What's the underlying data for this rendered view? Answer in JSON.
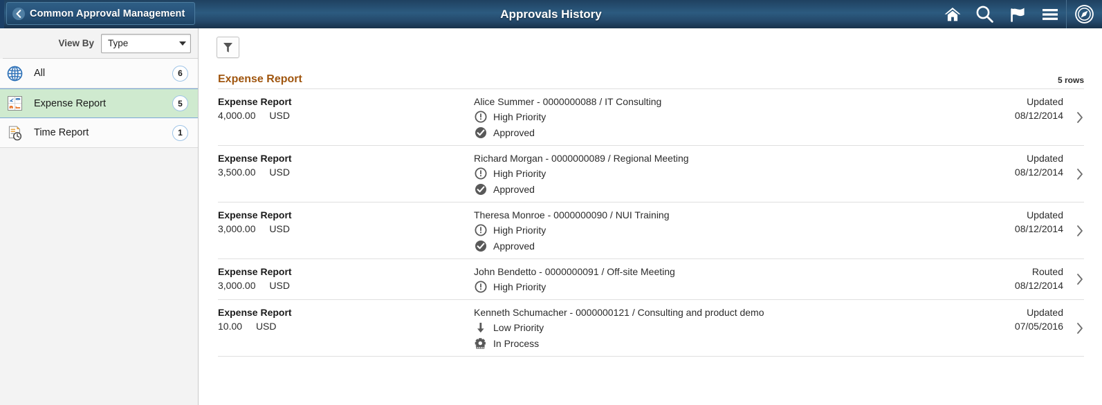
{
  "header": {
    "back_label": "Common Approval Management",
    "title": "Approvals History",
    "icons": [
      {
        "name": "home-icon",
        "label": "Home"
      },
      {
        "name": "search-icon",
        "label": "Search"
      },
      {
        "name": "flag-icon",
        "label": "Notifications"
      },
      {
        "name": "hamburger-menu-icon",
        "label": "Actions"
      },
      {
        "name": "navbar-compass-icon",
        "label": "NavBar"
      }
    ],
    "theme_color": "#2c5b80"
  },
  "sidebar": {
    "view_by_label": "View By",
    "view_by_value": "Type",
    "view_by_options": [
      "Type"
    ],
    "items": [
      {
        "label": "All",
        "count": "6",
        "icon": "globe-icon",
        "selected": false
      },
      {
        "label": "Expense Report",
        "count": "5",
        "icon": "expense-report-icon",
        "selected": true
      },
      {
        "label": "Time Report",
        "count": "1",
        "icon": "time-report-icon",
        "selected": false
      }
    ],
    "selected_bg": "#cfeacf"
  },
  "main": {
    "filter_button_icon": "filter-funnel-icon",
    "section_title": "Expense Report",
    "section_title_color": "#a0560f",
    "rows_count_label": "5 rows",
    "rows": [
      {
        "type": "Expense Report",
        "amount": "4,000.00",
        "currency": "USD",
        "detail": "Alice Summer - 0000000088 / IT Consulting",
        "priority": "High Priority",
        "priority_icon": "exclamation-circle-icon",
        "status": "Approved",
        "status_icon": "check-circle-icon",
        "updated_label": "Updated",
        "updated_date": "08/12/2014"
      },
      {
        "type": "Expense Report",
        "amount": "3,500.00",
        "currency": "USD",
        "detail": "Richard Morgan - 0000000089 / Regional Meeting",
        "priority": "High Priority",
        "priority_icon": "exclamation-circle-icon",
        "status": "Approved",
        "status_icon": "check-circle-icon",
        "updated_label": "Updated",
        "updated_date": "08/12/2014"
      },
      {
        "type": "Expense Report",
        "amount": "3,000.00",
        "currency": "USD",
        "detail": "Theresa Monroe - 0000000090 / NUI Training",
        "priority": "High Priority",
        "priority_icon": "exclamation-circle-icon",
        "status": "Approved",
        "status_icon": "check-circle-icon",
        "updated_label": "Updated",
        "updated_date": "08/12/2014"
      },
      {
        "type": "Expense Report",
        "amount": "3,000.00",
        "currency": "USD",
        "detail": "John Bendetto - 0000000091 / Off-site Meeting",
        "priority": "High Priority",
        "priority_icon": "exclamation-circle-icon",
        "status": "",
        "status_icon": "",
        "updated_label": "Routed",
        "updated_date": "08/12/2014"
      },
      {
        "type": "Expense Report",
        "amount": "10.00",
        "currency": "USD",
        "detail": "Kenneth Schumacher - 0000000121 / Consulting and product demo",
        "priority": "Low Priority",
        "priority_icon": "arrow-down-icon",
        "status": "In Process",
        "status_icon": "gear-icon",
        "updated_label": "Updated",
        "updated_date": "07/05/2016"
      }
    ],
    "row_arrow_icon": "chevron-right-icon"
  }
}
